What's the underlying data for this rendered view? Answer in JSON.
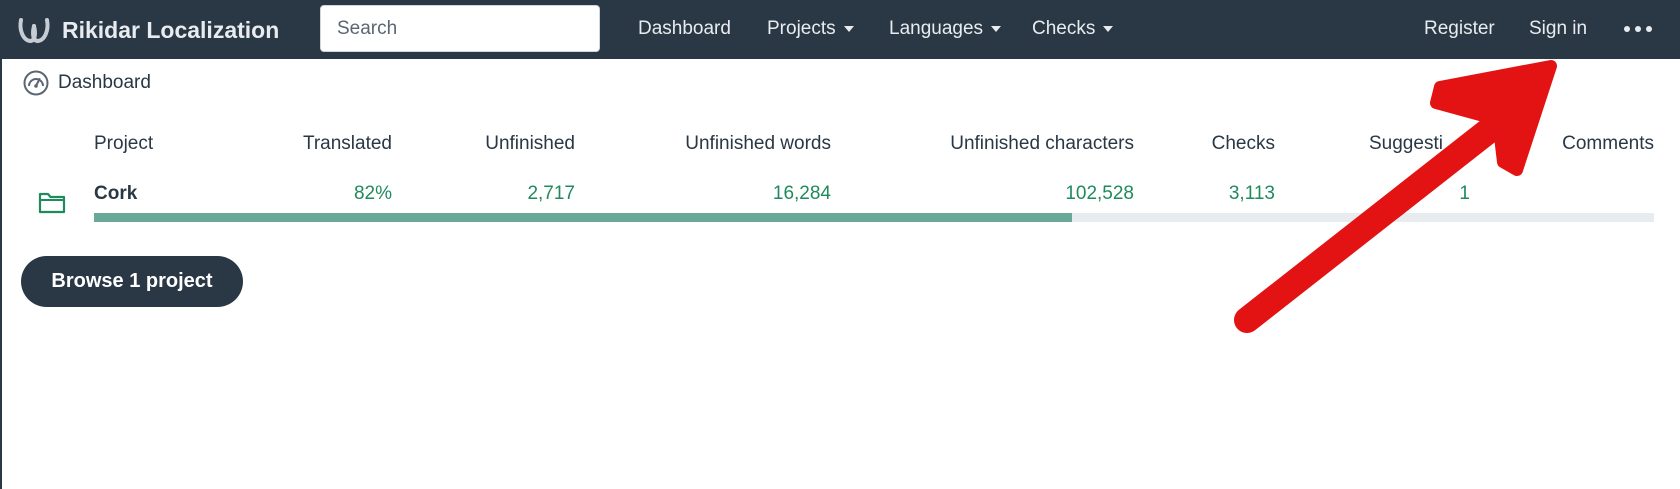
{
  "app": {
    "brand": "Rikidar Localization",
    "search_placeholder": "Search"
  },
  "nav": {
    "dashboard": "Dashboard",
    "projects": "Projects",
    "languages": "Languages",
    "checks": "Checks",
    "register": "Register",
    "sign_in": "Sign in"
  },
  "breadcrumb": {
    "label": "Dashboard"
  },
  "table": {
    "headers": {
      "project": "Project",
      "translated": "Translated",
      "unfinished": "Unfinished",
      "unfinished_words": "Unfinished words",
      "unfinished_characters": "Unfinished characters",
      "checks": "Checks",
      "suggestions": "Suggesti",
      "comments": "Comments"
    },
    "rows": [
      {
        "name": "Cork",
        "translated": "82%",
        "unfinished": "2,717",
        "unfinished_words": "16,284",
        "unfinished_characters": "102,528",
        "checks": "3,113",
        "suggestions": "1",
        "comments": "",
        "progress_percent": 62.7
      }
    ]
  },
  "actions": {
    "browse": "Browse 1 project"
  },
  "colors": {
    "navbar": "#2a3744",
    "link_green": "#1f8a5e",
    "progress": "#6aa897",
    "annotation_arrow": "#e31313"
  }
}
